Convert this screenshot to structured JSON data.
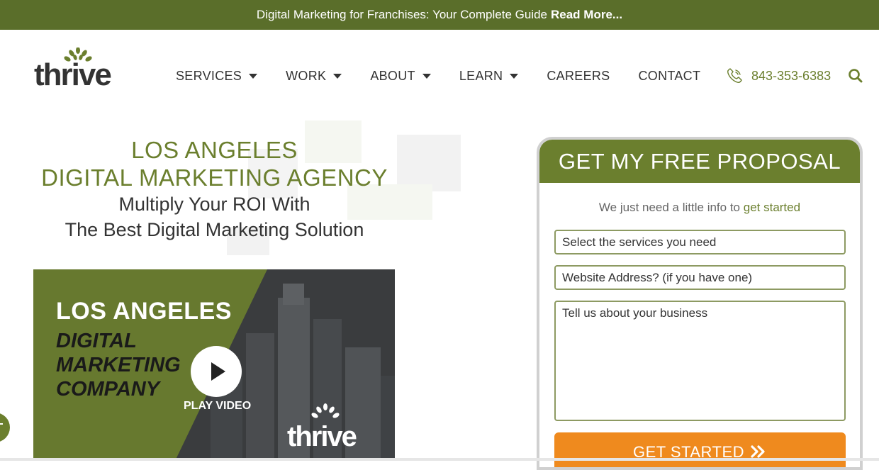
{
  "announcement": {
    "text": "Digital Marketing for Franchises: Your Complete Guide",
    "link": "Read More..."
  },
  "logo": {
    "text": "thrive"
  },
  "nav": {
    "items": [
      {
        "label": "SERVICES"
      },
      {
        "label": "WORK"
      },
      {
        "label": "ABOUT"
      },
      {
        "label": "LEARN"
      },
      {
        "label": "CAREERS"
      },
      {
        "label": "CONTACT"
      }
    ]
  },
  "phone": {
    "number": "843-353-6383",
    "icon": "phone-icon"
  },
  "search": {
    "icon": "search-icon"
  },
  "hero": {
    "title_line1": "LOS ANGELES",
    "title_line2": "DIGITAL MARKETING AGENCY",
    "sub_line1": "Multiply Your ROI With",
    "sub_line2": "The Best Digital Marketing Solution"
  },
  "video": {
    "title": "LOS ANGELES",
    "subtitle_line1": "DIGITAL",
    "subtitle_line2": "MARKETING",
    "subtitle_line3": "COMPANY",
    "play_label": "PLAY VIDEO",
    "logo_text": "thrive"
  },
  "proposal": {
    "heading": "GET MY FREE PROPOSAL",
    "intro": "We just need a little info to",
    "intro_link": "get started",
    "services_placeholder": "Select the services you need",
    "website_placeholder": "Website Address? (if you have one)",
    "business_placeholder": "Tell us about your business",
    "submit_label": "GET STARTED"
  },
  "colors": {
    "brand_green": "#6b7f2e",
    "topbar_green": "#5a6e2a",
    "cta_orange": "#ef8a1e"
  }
}
